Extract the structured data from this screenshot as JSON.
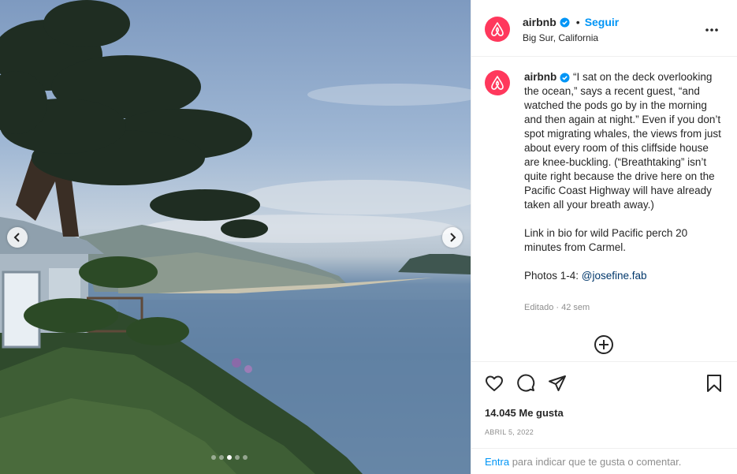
{
  "post": {
    "photo": {
      "alt_icon_left": "chevron-left-icon",
      "alt_icon_right": "chevron-right-icon",
      "carousel_total": 5,
      "carousel_current": 3
    },
    "header": {
      "username": "airbnb",
      "separator": "•",
      "follow_label": "Seguir",
      "location": "Big Sur, California"
    },
    "caption": {
      "username": "airbnb",
      "paragraph1": "“I sat on the deck overlooking the ocean,” says a recent guest, “and watched the pods go by in the morning and then again at night.” Even if you don’t spot migrating whales, the views from just about every room of this cliffside house are knee-buckling. (“Breathtaking” isn’t quite right because the drive here on the Pacific Coast Highway will have already taken all your breath away.)",
      "paragraph2": "Link in bio for wild Pacific perch 20 minutes from Carmel.",
      "photos_prefix": "Photos 1-4: ",
      "photos_mention": "@josefine.fab",
      "meta": "Editado · 42 sem"
    },
    "likes": "14.045 Me gusta",
    "date": "ABRIL 5, 2022",
    "add_comment": {
      "login_label": "Entra",
      "rest": " para indicar que te gusta o comentar."
    }
  },
  "colors": {
    "brand": "#ff385c",
    "link": "#0095f6",
    "mention": "#00376b",
    "muted": "#8e8e8e"
  }
}
